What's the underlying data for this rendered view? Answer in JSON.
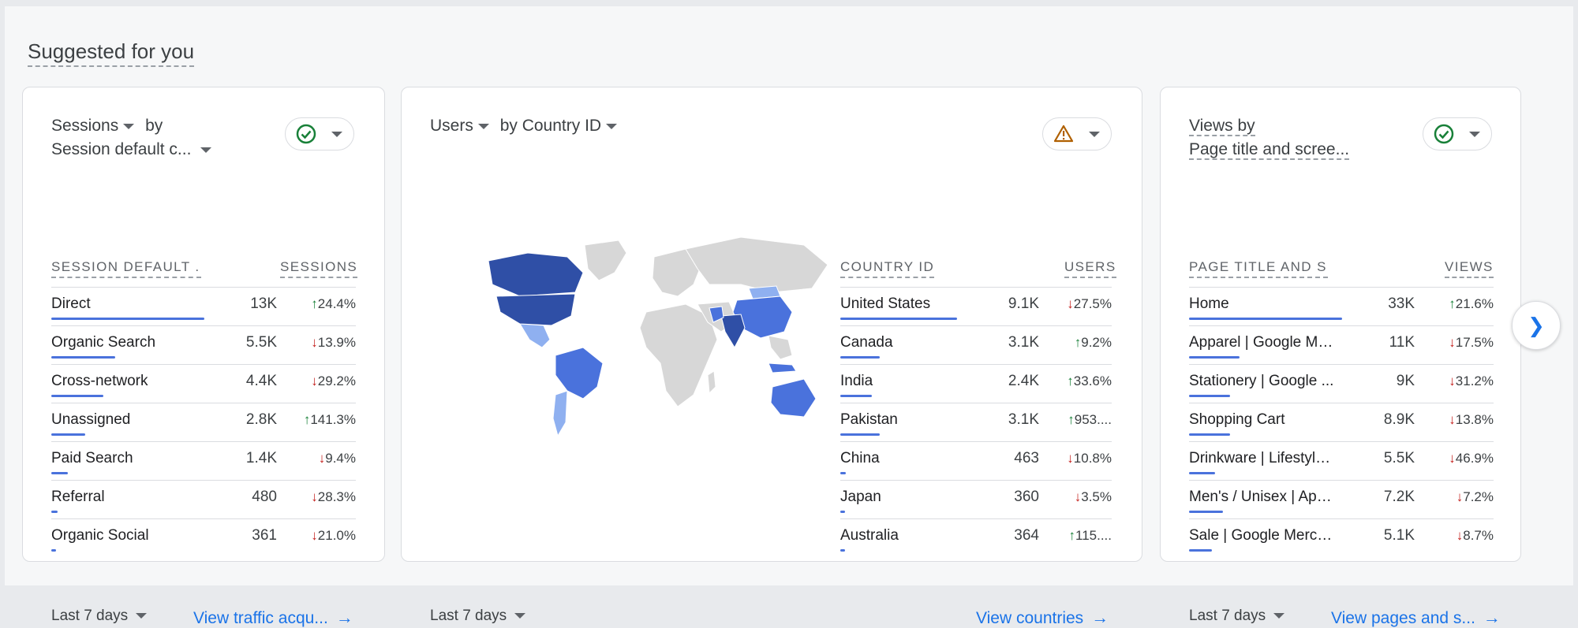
{
  "section_title": "Suggested for you",
  "cards": [
    {
      "title_metric": "Sessions",
      "title_by": "by",
      "title_dimension": "Session default c...",
      "status": "ok",
      "col_dimension": "SESSION DEFAULT ...",
      "col_metric": "SESSIONS",
      "rows": [
        {
          "name": "Direct",
          "value": "13K",
          "dir": "up",
          "change": "24.4%",
          "bar": 1.0
        },
        {
          "name": "Organic Search",
          "value": "5.5K",
          "dir": "down",
          "change": "13.9%",
          "bar": 0.42
        },
        {
          "name": "Cross-network",
          "value": "4.4K",
          "dir": "down",
          "change": "29.2%",
          "bar": 0.34
        },
        {
          "name": "Unassigned",
          "value": "2.8K",
          "dir": "up",
          "change": "141.3%",
          "bar": 0.22
        },
        {
          "name": "Paid Search",
          "value": "1.4K",
          "dir": "down",
          "change": "9.4%",
          "bar": 0.11
        },
        {
          "name": "Referral",
          "value": "480",
          "dir": "down",
          "change": "28.3%",
          "bar": 0.04
        },
        {
          "name": "Organic Social",
          "value": "361",
          "dir": "down",
          "change": "21.0%",
          "bar": 0.03
        }
      ],
      "period": "Last 7 days",
      "link": "View traffic acqu..."
    },
    {
      "title_metric": "Users",
      "title_dimension": "by Country ID",
      "status": "warning",
      "col_dimension": "COUNTRY ID",
      "col_metric": "USERS",
      "rows": [
        {
          "name": "United States",
          "value": "9.1K",
          "dir": "down",
          "change": "27.5%",
          "bar": 1.0
        },
        {
          "name": "Canada",
          "value": "3.1K",
          "dir": "up",
          "change": "9.2%",
          "bar": 0.34
        },
        {
          "name": "India",
          "value": "2.4K",
          "dir": "up",
          "change": "33.6%",
          "bar": 0.27
        },
        {
          "name": "Pakistan",
          "value": "3.1K",
          "dir": "up",
          "change": "953....",
          "bar": 0.34
        },
        {
          "name": "China",
          "value": "463",
          "dir": "down",
          "change": "10.8%",
          "bar": 0.05
        },
        {
          "name": "Japan",
          "value": "360",
          "dir": "down",
          "change": "3.5%",
          "bar": 0.04
        },
        {
          "name": "Australia",
          "value": "364",
          "dir": "up",
          "change": "115....",
          "bar": 0.04
        }
      ],
      "period": "Last 7 days",
      "link": "View countries"
    },
    {
      "title_metric": "Views by",
      "title_dimension": "Page title and scree...",
      "status": "ok",
      "col_dimension": "PAGE TITLE AND S...",
      "col_metric": "VIEWS",
      "rows": [
        {
          "name": "Home",
          "value": "33K",
          "dir": "up",
          "change": "21.6%",
          "bar": 1.0
        },
        {
          "name": "Apparel | Google Mer...",
          "value": "11K",
          "dir": "down",
          "change": "17.5%",
          "bar": 0.33
        },
        {
          "name": "Stationery | Google ...",
          "value": "9K",
          "dir": "down",
          "change": "31.2%",
          "bar": 0.27
        },
        {
          "name": "Shopping Cart",
          "value": "8.9K",
          "dir": "down",
          "change": "13.8%",
          "bar": 0.27
        },
        {
          "name": "Drinkware | Lifestyle ...",
          "value": "5.5K",
          "dir": "down",
          "change": "46.9%",
          "bar": 0.17
        },
        {
          "name": "Men's / Unisex | Appa...",
          "value": "7.2K",
          "dir": "down",
          "change": "7.2%",
          "bar": 0.22
        },
        {
          "name": "Sale | Google Mercha...",
          "value": "5.1K",
          "dir": "down",
          "change": "8.7%",
          "bar": 0.15
        }
      ],
      "period": "Last 7 days",
      "link": "View pages and s..."
    }
  ],
  "colors": {
    "bar": "#4a72dc",
    "up": "#188038",
    "down": "#c5221f",
    "link": "#1a73e8",
    "map_dark": "#2f4fa6",
    "map_mid": "#4a72dc",
    "map_light": "#8fb0f0",
    "map_none": "#d7d7d7"
  }
}
